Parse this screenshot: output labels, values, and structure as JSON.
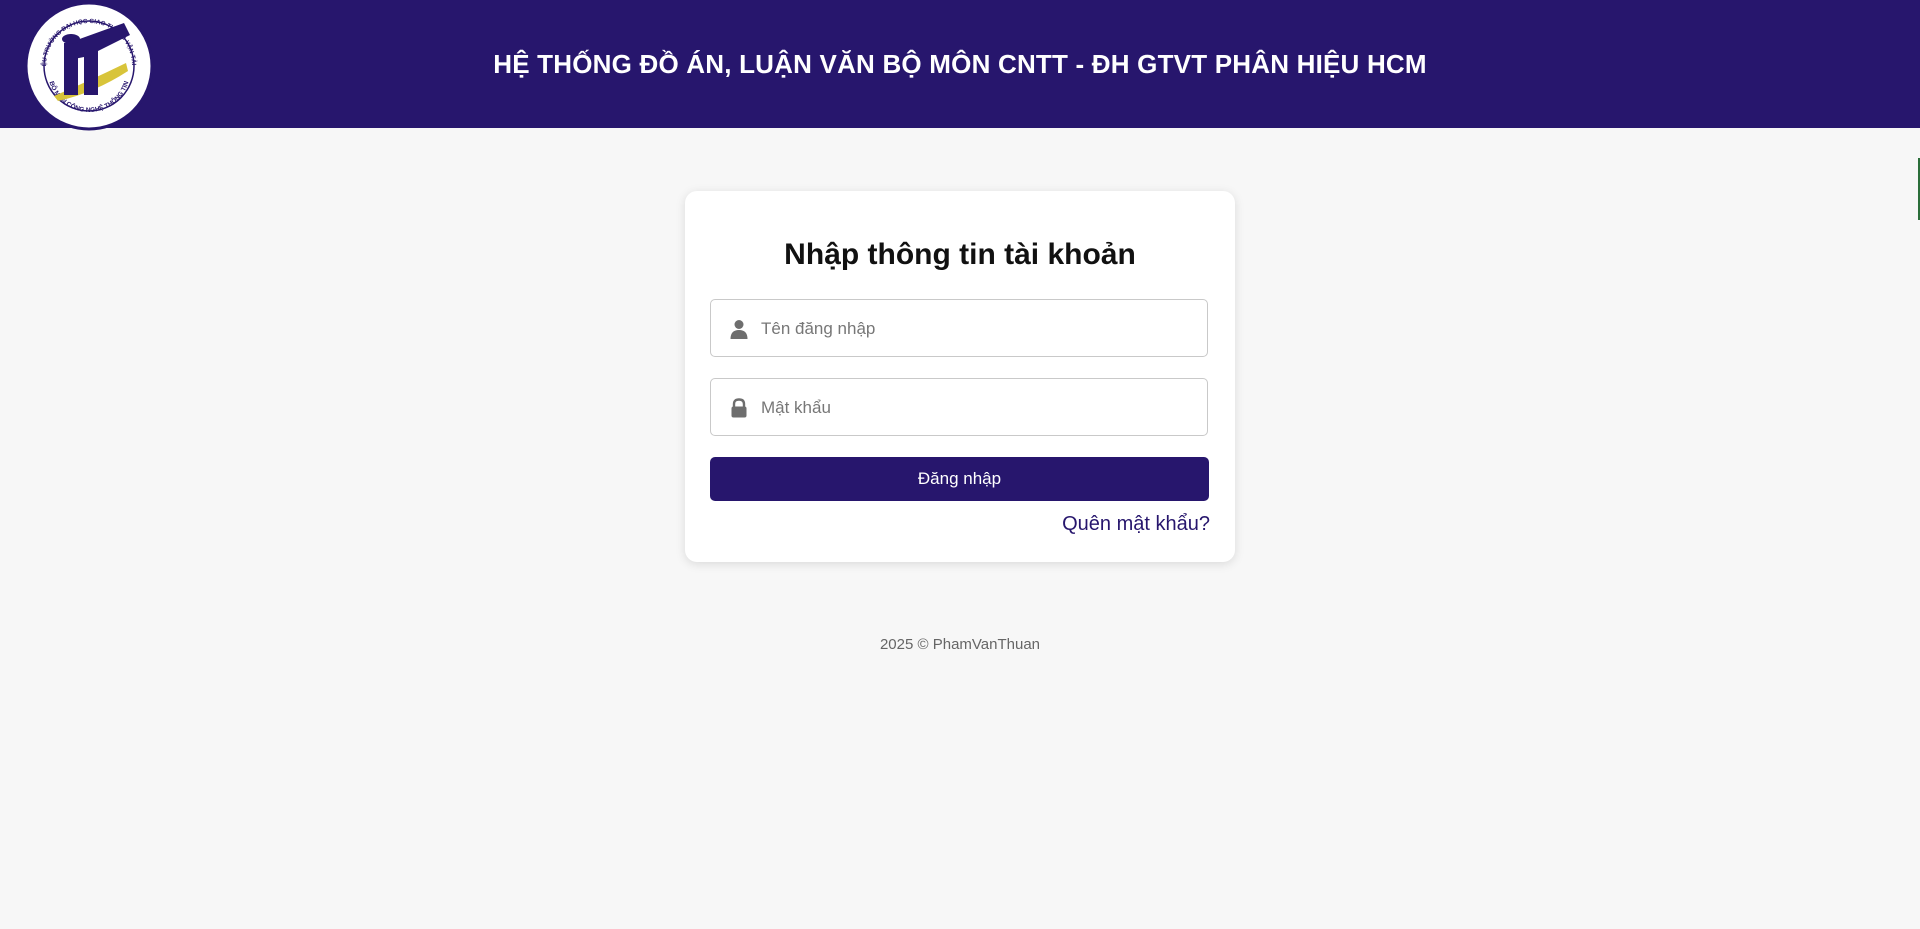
{
  "header": {
    "title": "HỆ THỐNG ĐỒ ÁN, LUẬN VĂN BỘ MÔN CNTT - ĐH GTVT PHÂN HIỆU HCM",
    "logo_icon": "university-seal-icon",
    "logo_text_top": "PHÂN HIỆU TRƯỜNG ĐẠI HỌC GIAO THÔNG VẬN TẢI TP. HCM",
    "logo_text_bottom": "BỘ MÔN CÔNG NGHỆ THÔNG TIN"
  },
  "login": {
    "title": "Nhập thông tin tài khoản",
    "username_placeholder": "Tên đăng nhập",
    "username_value": "",
    "username_icon": "user-icon",
    "password_placeholder": "Mật khẩu",
    "password_value": "",
    "password_icon": "lock-icon",
    "submit_label": "Đăng nhập",
    "forgot_label": "Quên mật khẩu?"
  },
  "footer": {
    "text": "2025 © PhamVanThuan"
  },
  "colors": {
    "brand": "#27166d",
    "background": "#f7f7f7",
    "card": "#ffffff"
  }
}
